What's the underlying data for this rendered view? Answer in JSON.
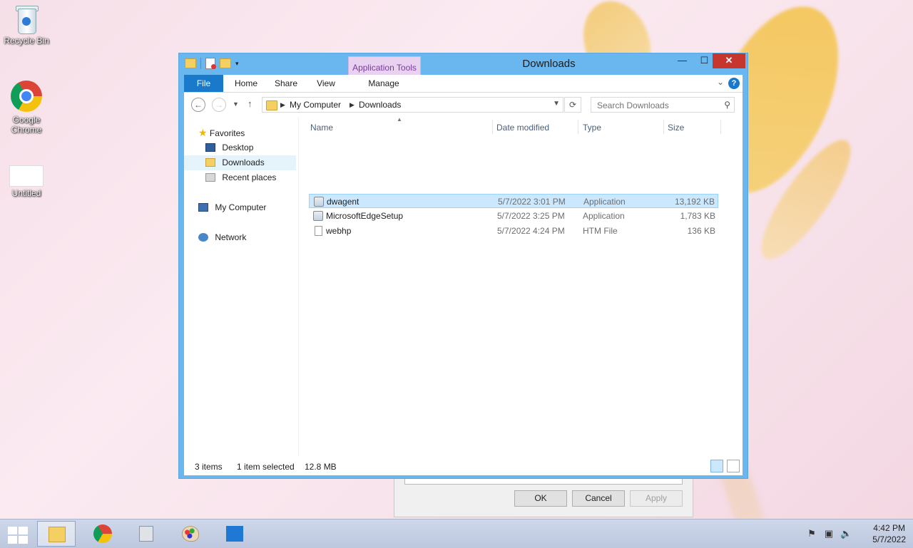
{
  "desktop": {
    "icons": [
      {
        "label": "Recycle Bin"
      },
      {
        "label": "Google Chrome"
      },
      {
        "label": "Untitled"
      }
    ]
  },
  "back_dialog": {
    "ok_label": "OK",
    "cancel_label": "Cancel",
    "apply_label": "Apply"
  },
  "window": {
    "title": "Downloads",
    "contextual_tab_group": "Application Tools",
    "controls": {
      "minimize": "—",
      "maximize": "☐",
      "close": "✕"
    },
    "ribbon": {
      "tabs": [
        "File",
        "Home",
        "Share",
        "View",
        "Manage"
      ],
      "help": "?"
    },
    "address": {
      "crumbs": [
        "My Computer",
        "Downloads"
      ]
    },
    "search": {
      "placeholder": "Search Downloads"
    },
    "nav_pane": {
      "favorites": "Favorites",
      "desktop": "Desktop",
      "downloads": "Downloads",
      "recent": "Recent places",
      "computer": "My Computer",
      "network": "Network"
    },
    "columns": {
      "name": "Name",
      "date": "Date modified",
      "type": "Type",
      "size": "Size"
    },
    "files": [
      {
        "name": "dwagent",
        "date": "5/7/2022 3:01 PM",
        "type": "Application",
        "size": "13,192 KB"
      },
      {
        "name": "MicrosoftEdgeSetup",
        "date": "5/7/2022 3:25 PM",
        "type": "Application",
        "size": "1,783 KB"
      },
      {
        "name": "webhp",
        "date": "5/7/2022 4:24 PM",
        "type": "HTM File",
        "size": "136 KB"
      }
    ],
    "status": {
      "count": "3 items",
      "selection": "1 item selected",
      "size": "12.8 MB"
    }
  },
  "taskbar": {
    "clock_time": "4:42 PM",
    "clock_date": "5/7/2022"
  },
  "colors": {
    "titlebar": "#6ab7f0",
    "file_tab": "#1979ca",
    "close_button": "#c7362e",
    "selection": "#cce8ff",
    "contextual_tab": "#e8d2f0"
  }
}
